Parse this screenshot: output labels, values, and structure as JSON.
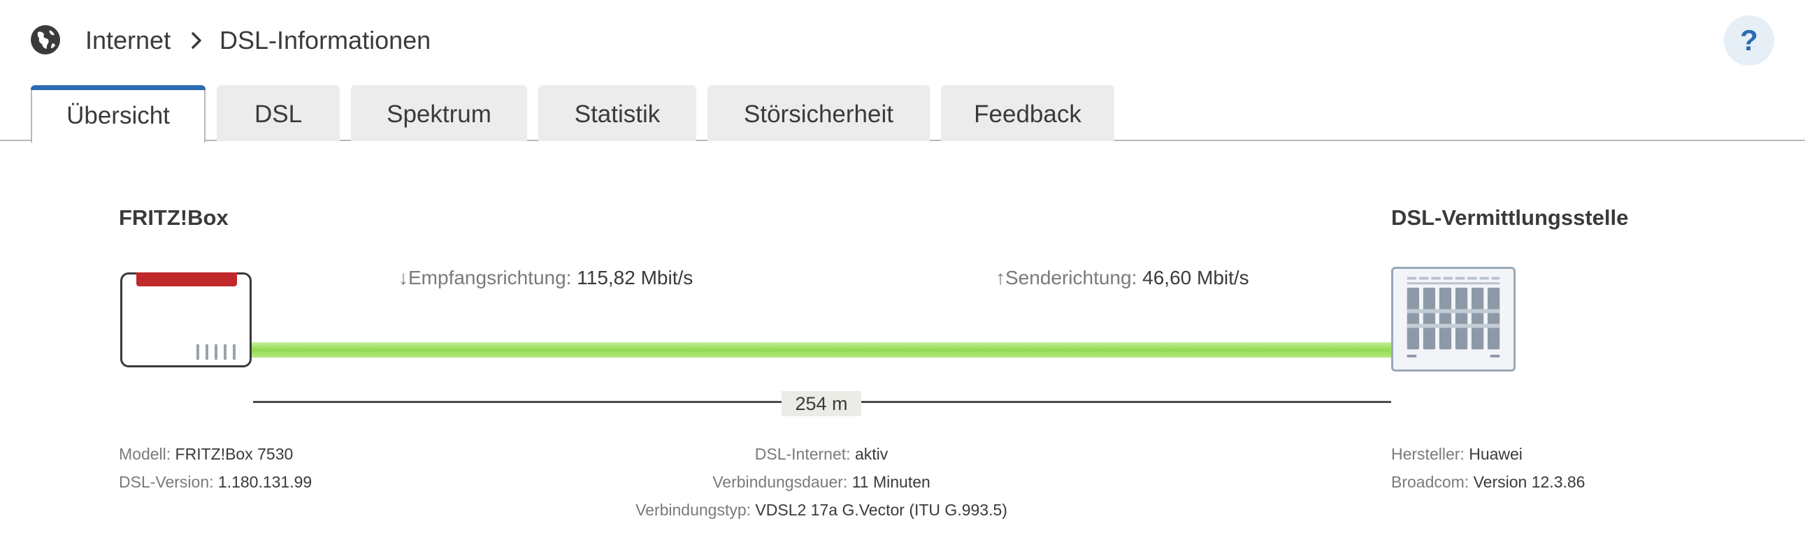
{
  "header": {
    "breadcrumb_root": "Internet",
    "breadcrumb_current": "DSL-Informationen",
    "help_label": "?"
  },
  "tabs": [
    {
      "label": "Übersicht",
      "active": true
    },
    {
      "label": "DSL",
      "active": false
    },
    {
      "label": "Spektrum",
      "active": false
    },
    {
      "label": "Statistik",
      "active": false
    },
    {
      "label": "Störsicherheit",
      "active": false
    },
    {
      "label": "Feedback",
      "active": false
    }
  ],
  "diagram": {
    "left_title": "FRITZ!Box",
    "right_title": "DSL-Vermittlungsstelle",
    "downstream_label": "↓Empfangsrichtung:",
    "downstream_value": "115,82 Mbit/s",
    "upstream_label": "↑Senderichtung:",
    "upstream_value": "46,60 Mbit/s",
    "distance": "254 m",
    "line_color": "#92da4f"
  },
  "info_left": {
    "model_label": "Modell:",
    "model_value": "FRITZ!Box 7530",
    "version_label": "DSL-Version:",
    "version_value": "1.180.131.99"
  },
  "info_center": {
    "internet_label": "DSL-Internet:",
    "internet_value": "aktiv",
    "duration_label": "Verbindungsdauer:",
    "duration_value": "11 Minuten",
    "type_label": "Verbindungstyp:",
    "type_value": "VDSL2 17a G.Vector (ITU G.993.5)"
  },
  "info_right": {
    "vendor_label": "Hersteller:",
    "vendor_value": "Huawei",
    "chip_label": "Broadcom:",
    "chip_value": "Version 12.3.86"
  },
  "icons": {
    "globe": "globe-icon",
    "chevron": "chevron-right-icon"
  },
  "colors": {
    "accent": "#2d6bb3",
    "fritz_red": "#c0282a"
  }
}
